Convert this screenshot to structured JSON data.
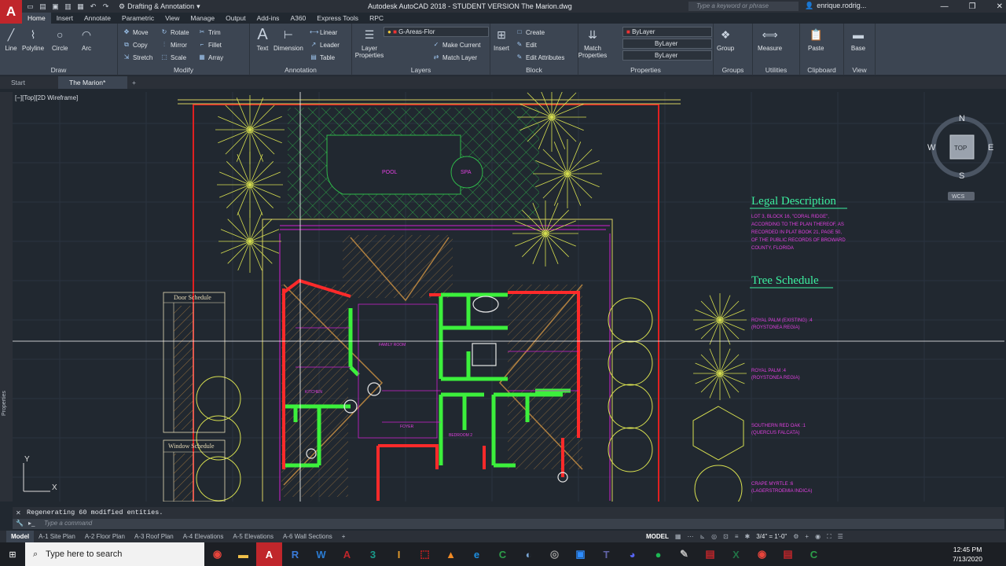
{
  "app": {
    "logo": "A",
    "title": "Autodesk AutoCAD 2018 - STUDENT VERSION    The Marion.dwg",
    "workspace": "Drafting & Annotation",
    "search_placeholder": "Type a keyword or phrase",
    "user": "enrique.rodrig..."
  },
  "ribbon": {
    "tabs": [
      "Home",
      "Insert",
      "Annotate",
      "Parametric",
      "View",
      "Manage",
      "Output",
      "Add-ins",
      "A360",
      "Express Tools",
      "RPC"
    ],
    "draw": {
      "title": "Draw",
      "line": "Line",
      "polyline": "Polyline",
      "circle": "Circle",
      "arc": "Arc"
    },
    "modify": {
      "title": "Modify",
      "move": "Move",
      "rotate": "Rotate",
      "trim": "Trim",
      "copy": "Copy",
      "mirror": "Mirror",
      "fillet": "Fillet",
      "stretch": "Stretch",
      "scale": "Scale",
      "array": "Array"
    },
    "annotation": {
      "title": "Annotation",
      "text": "Text",
      "dimension": "Dimension",
      "linear": "Linear",
      "leader": "Leader",
      "table": "Table"
    },
    "layers": {
      "title": "Layers",
      "layer_properties": "Layer Properties",
      "current_layer": "G-Areas-Flor",
      "make_current": "Make Current",
      "match_layer": "Match Layer"
    },
    "block": {
      "title": "Block",
      "insert": "Insert",
      "create": "Create",
      "edit": "Edit",
      "edit_attributes": "Edit Attributes"
    },
    "properties": {
      "title": "Properties",
      "match_properties": "Match Properties",
      "color": "ByLayer",
      "linetype": "ByLayer",
      "lineweight": "ByLayer"
    },
    "groups": {
      "title": "Groups",
      "group": "Group"
    },
    "utilities": {
      "title": "Utilities",
      "measure": "Measure"
    },
    "clipboard": {
      "title": "Clipboard",
      "paste": "Paste"
    },
    "view": {
      "title": "View",
      "base": "Base"
    }
  },
  "doc_tabs": [
    "Start",
    "The Marion*"
  ],
  "viewport": {
    "label": "[−][Top][2D Wireframe]"
  },
  "viewcube": {
    "top": "TOP",
    "n": "N",
    "s": "S",
    "e": "E",
    "w": "W",
    "wcs": "WCS"
  },
  "ucs": {
    "x": "X",
    "y": "Y"
  },
  "drawing": {
    "legal_title": "Legal Description",
    "legal_text": [
      "LOT 3, BLOCK 16, \"CORAL RIDGE\",",
      "ACCORDING TO THE PLAN THEREOF, AS",
      "RECORDED IN PLAT BOOK 21, PAGE 50,",
      "OF THE PUBLIC RECORDS OF BROWARD",
      "COUNTY, FLORIDA"
    ],
    "tree_title": "Tree Schedule",
    "trees": [
      [
        "ROYAL PALM (EXISTING) :4",
        "(ROYSTONEA REGIA)"
      ],
      [
        "ROYAL PALM :4",
        "(ROYSTONEA REGIA)"
      ],
      [
        "SOUTHERN RED OAK :1",
        "(QUERCUS FALCATA)"
      ],
      [
        "CRAPE MYRTLE :6",
        "(LAGERSTROEMIA INDICA)"
      ]
    ],
    "door_schedule": "Door Schedule",
    "window_schedule": "Window Schedule",
    "rooms": {
      "pool": "POOL",
      "spa": "SPA",
      "family": "FAMILY ROOM",
      "kitchen": "KITCHEN",
      "bedroom": "BEDROOM 2",
      "foyer": "FOYER"
    }
  },
  "command": {
    "history": "Regenerating 60 modified entities.",
    "placeholder": "Type a command"
  },
  "layout_tabs": [
    "Model",
    "A-1 Site Plan",
    "A-2 Floor Plan",
    "A-3 Roof Plan",
    "A-4 Elevations",
    "A-5 Elevations",
    "A-6 Wall Sections"
  ],
  "status": {
    "model": "MODEL",
    "scale": "3/4\" = 1'-0\""
  },
  "taskbar": {
    "search": "Type here to search",
    "time": "12:45 PM",
    "date": "7/13/2020"
  }
}
